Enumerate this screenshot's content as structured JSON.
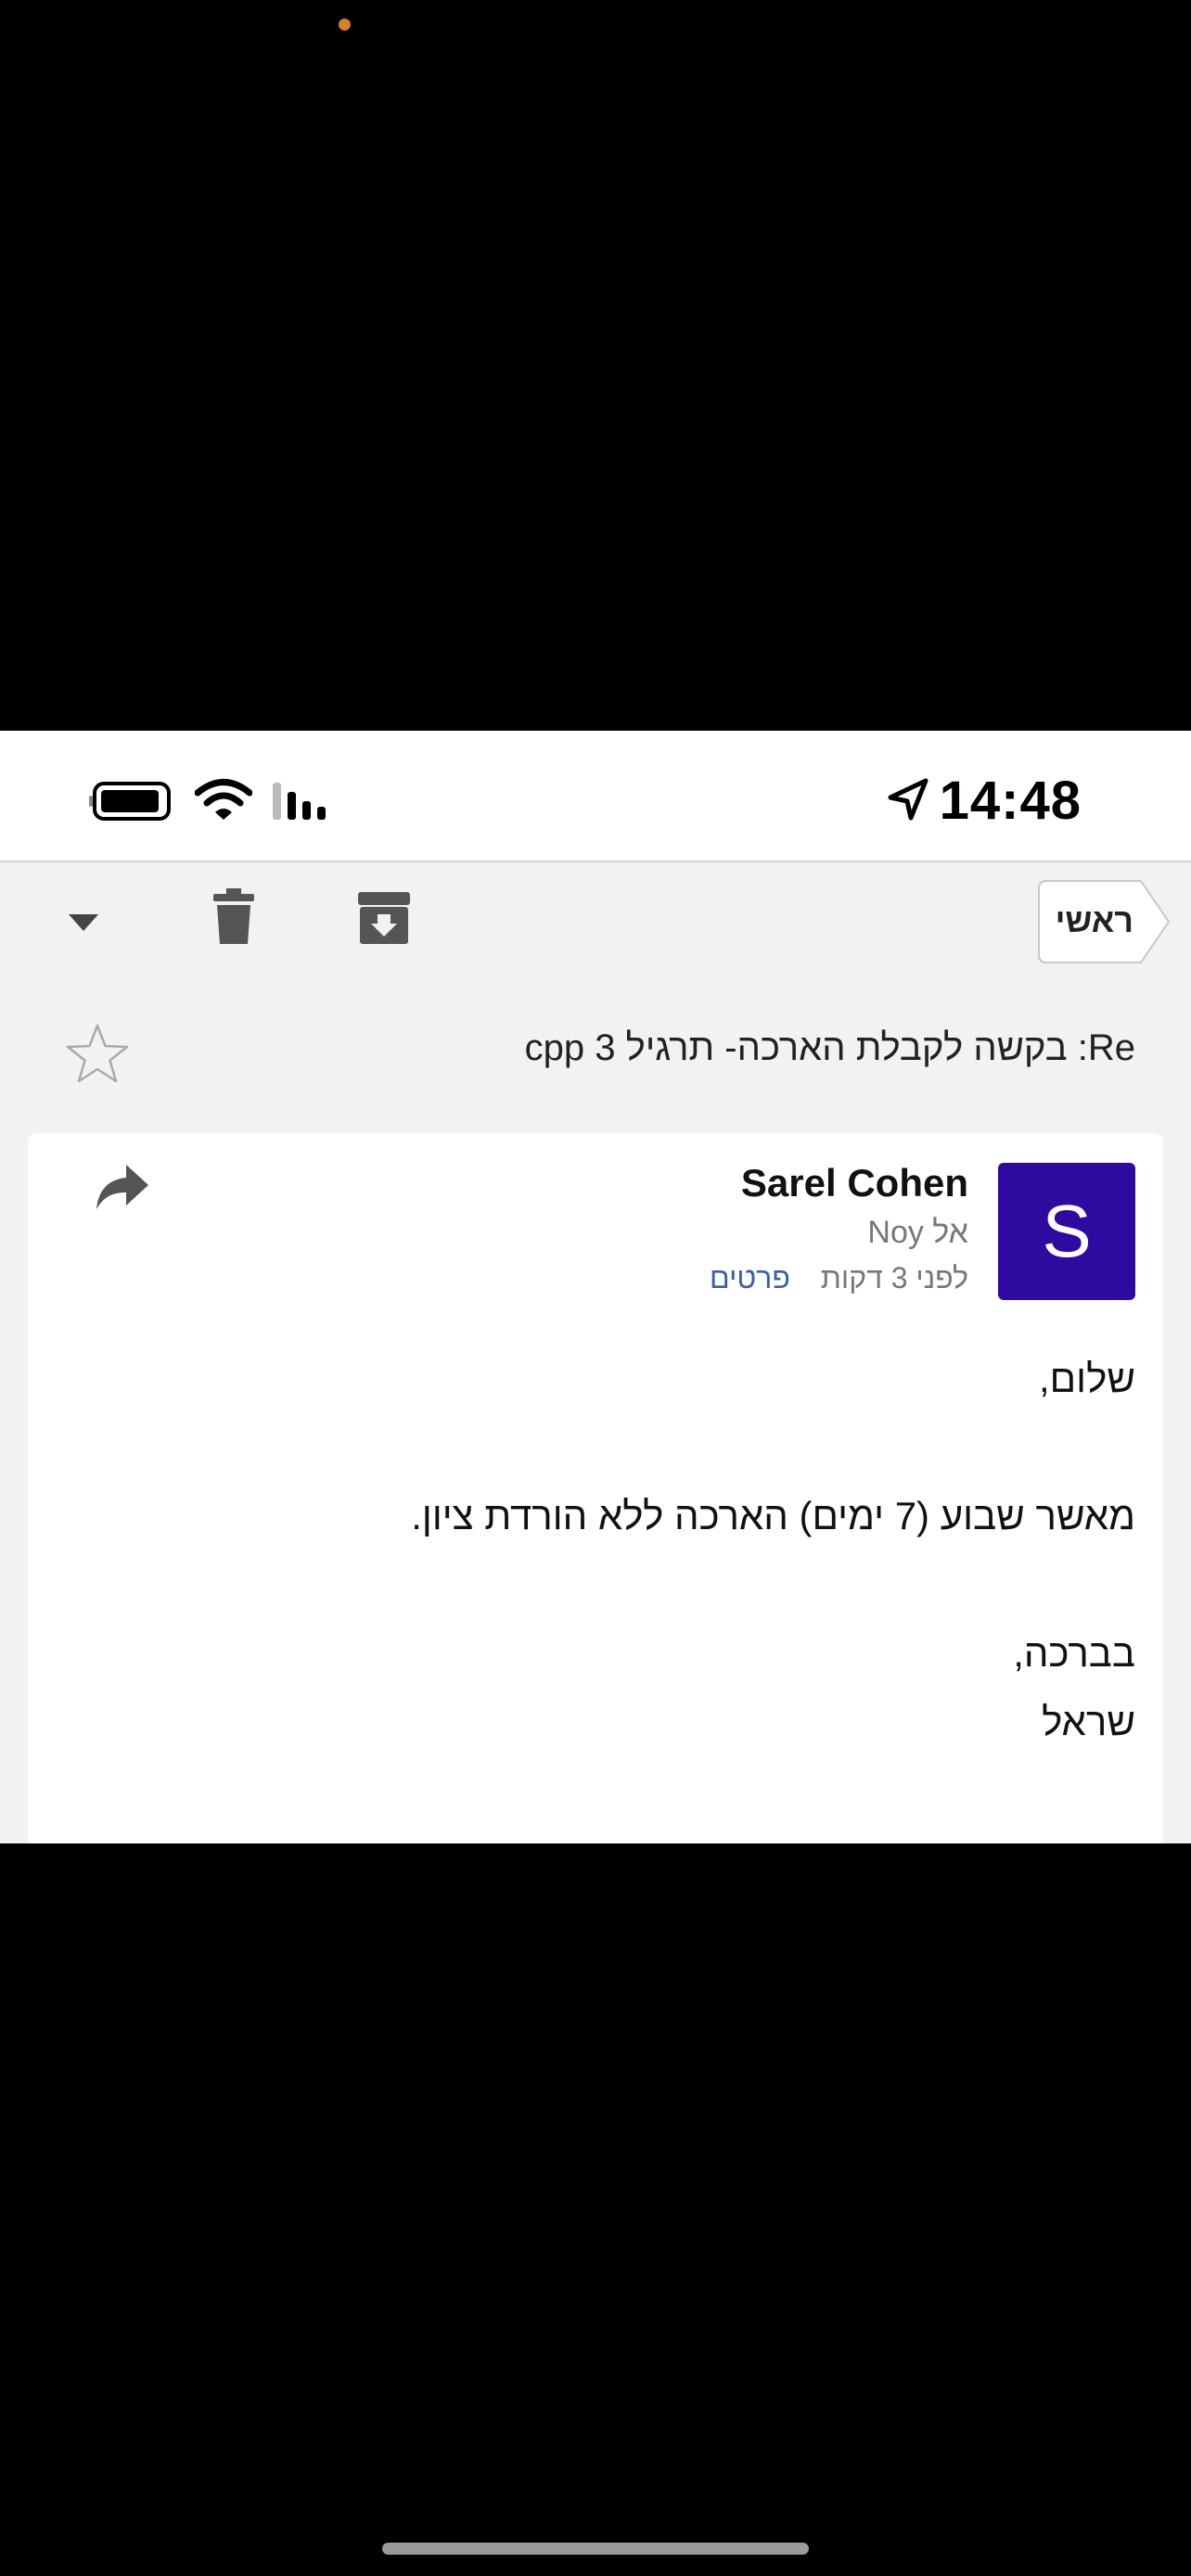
{
  "status_bar": {
    "time": "14:48",
    "icons": [
      "location-arrow-icon",
      "battery-icon",
      "wifi-icon",
      "signal-icon"
    ]
  },
  "toolbar": {
    "back_label": "ראשי",
    "icons": [
      "chevron-down-icon",
      "trash-icon",
      "archive-icon"
    ]
  },
  "email": {
    "subject": "Re: בקשה לקבלת הארכה- תרגיל 3 cpp",
    "sender_name": "Sarel Cohen",
    "avatar_letter": "S",
    "to_line": "אל Noy",
    "time_ago": "לפני 3 דקות",
    "details_link": "פרטים",
    "body": {
      "greeting": "שלום,",
      "line1": "מאשר שבוע (7 ימים) הארכה ללא הורדת ציון.",
      "closing": "בברכה,",
      "signature": "שראל"
    }
  },
  "colors": {
    "accent": "#3c5fa6",
    "avatar_bg": "#2f0aa1",
    "dot": "#d6802f"
  }
}
